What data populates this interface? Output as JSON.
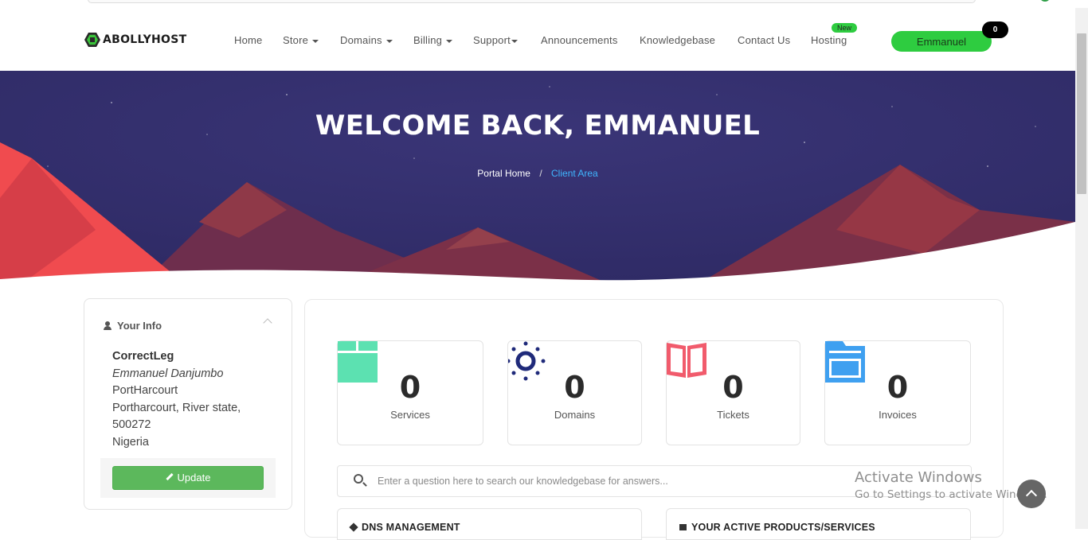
{
  "header": {
    "logo_text": "ABOLLYHOST",
    "nav": [
      {
        "label": "Home",
        "dropdown": false
      },
      {
        "label": "Store",
        "dropdown": true
      },
      {
        "label": "Domains",
        "dropdown": true
      },
      {
        "label": "Billing",
        "dropdown": true
      },
      {
        "label": "Support",
        "dropdown": true
      },
      {
        "label": "Announcements",
        "dropdown": false
      },
      {
        "label": "Knowledgebase",
        "dropdown": false
      },
      {
        "label": "Contact Us",
        "dropdown": false
      },
      {
        "label": "Hosting",
        "dropdown": false
      }
    ],
    "hosting_badge": "New",
    "user_button": "Emmanuel",
    "cart_count": "0"
  },
  "hero": {
    "title": "WELCOME BACK, EMMANUEL",
    "breadcrumb": [
      {
        "label": "Portal Home"
      },
      {
        "label": "Client Area"
      }
    ],
    "separator": "/"
  },
  "your_info": {
    "title": "Your Info",
    "company": "CorrectLeg",
    "name": "Emmanuel Danjumbo",
    "city": "PortHarcourt",
    "region": "Portharcourt, River state,",
    "postcode": "500272",
    "country": "Nigeria",
    "update_button": "Update"
  },
  "stats": [
    {
      "value": "0",
      "label": "Services",
      "color": "#5ce1b1",
      "icon": "box-icon"
    },
    {
      "value": "0",
      "label": "Domains",
      "color": "#1f2a7a",
      "icon": "globe-icon"
    },
    {
      "value": "0",
      "label": "Tickets",
      "color": "#f15b6c",
      "icon": "book-icon"
    },
    {
      "value": "0",
      "label": "Invoices",
      "color": "#3fa0f0",
      "icon": "folder-icon"
    }
  ],
  "kb_search": {
    "placeholder": "Enter a question here to search our knowledgebase for answers..."
  },
  "panels": {
    "dns": "DNS MANAGEMENT",
    "products": "YOUR ACTIVE PRODUCTS/SERVICES"
  },
  "watermark": {
    "line1": "Activate Windows",
    "line2": "Go to Settings to activate Windows."
  },
  "colors": {
    "hero_bg": "#35316f",
    "accent_green": "#2ecc40",
    "update_green": "#5cb85c",
    "link_blue": "#3fb6ff"
  }
}
